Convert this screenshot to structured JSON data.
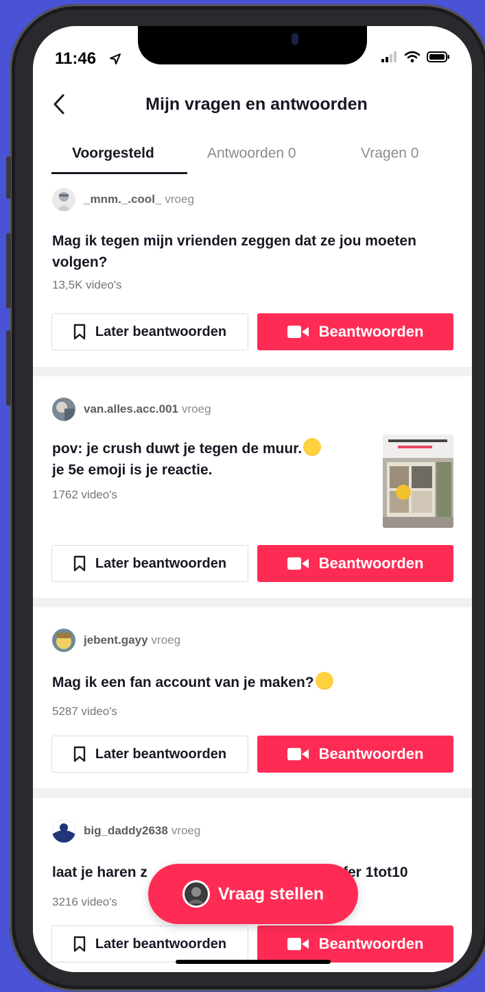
{
  "status": {
    "time": "11:46"
  },
  "header": {
    "title": "Mijn vragen en antwoorden"
  },
  "tabs": [
    {
      "label": "Voorgesteld",
      "active": true
    },
    {
      "label": "Antwoorden 0",
      "active": false
    },
    {
      "label": "Vragen 0",
      "active": false
    }
  ],
  "questions": [
    {
      "username": "_mnm._.cool_",
      "when": "vroeg",
      "text": "Mag ik tegen mijn vrienden zeggen dat ze jou moeten volgen?",
      "count": "13,5K video's"
    },
    {
      "username": "van.alles.acc.001",
      "when": "vroeg",
      "text_line1": "pov: je crush duwt je tegen de muur.",
      "text_line2": "je 5e emoji is je reactie.",
      "count": "1762 video's",
      "emoji": "smiling-face-with-hearts"
    },
    {
      "username": "jebent.gayy",
      "when": "vroeg",
      "text": "Mag ik een fan account van je maken?",
      "count": "5287 video's",
      "emoji": "heart-eyes"
    },
    {
      "username": "big_daddy2638",
      "when": "vroeg",
      "text_left": "laat je haren z",
      "text_right": "fer 1tot10",
      "count": "3216 video's"
    }
  ],
  "buttons": {
    "later_label": "Later beantwoorden",
    "answer_label": "Beantwoorden"
  },
  "fab": {
    "label": "Vraag stellen"
  },
  "colors": {
    "accent": "#fe2c55",
    "background": "#4a52d6",
    "text": "#161823",
    "separator": "#f1f1f2"
  }
}
